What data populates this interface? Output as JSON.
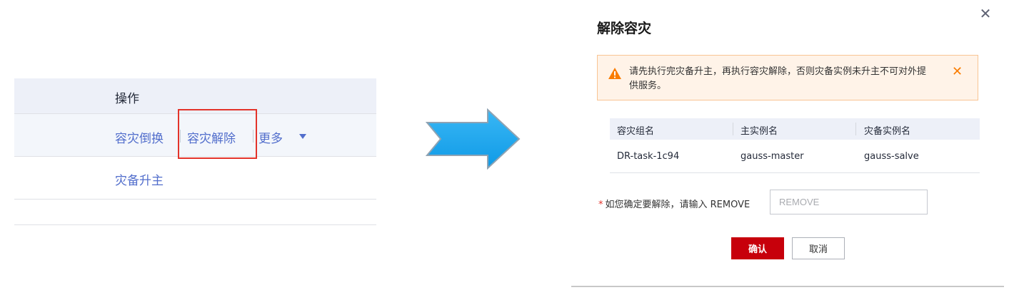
{
  "left_table": {
    "header": "操作",
    "row1": {
      "switch": "容灾倒换",
      "remove": "容灾解除",
      "more": "更多"
    },
    "row2": {
      "promote": "灾备升主"
    }
  },
  "arrow": {
    "color": "#1ea9f0"
  },
  "dialog": {
    "title": "解除容灾",
    "close_icon": "close-icon",
    "alert": {
      "icon": "warning-icon",
      "text": "请先执行完灾备升主，再执行容灾解除，否则灾备实例未升主不可对外提供服务。",
      "close_icon": "close-icon",
      "color": "#fa7c00"
    },
    "table": {
      "columns": [
        "容灾组名",
        "主实例名",
        "灾备实例名"
      ],
      "rows": [
        [
          "DR-task-1c94",
          "gauss-master",
          "gauss-salve"
        ]
      ]
    },
    "confirm": {
      "required_mark": "*",
      "label": "如您确定要解除，请输入 REMOVE",
      "placeholder": "REMOVE",
      "value": ""
    },
    "buttons": {
      "ok": "确认",
      "cancel": "取消",
      "ok_color": "#c7000b"
    }
  }
}
